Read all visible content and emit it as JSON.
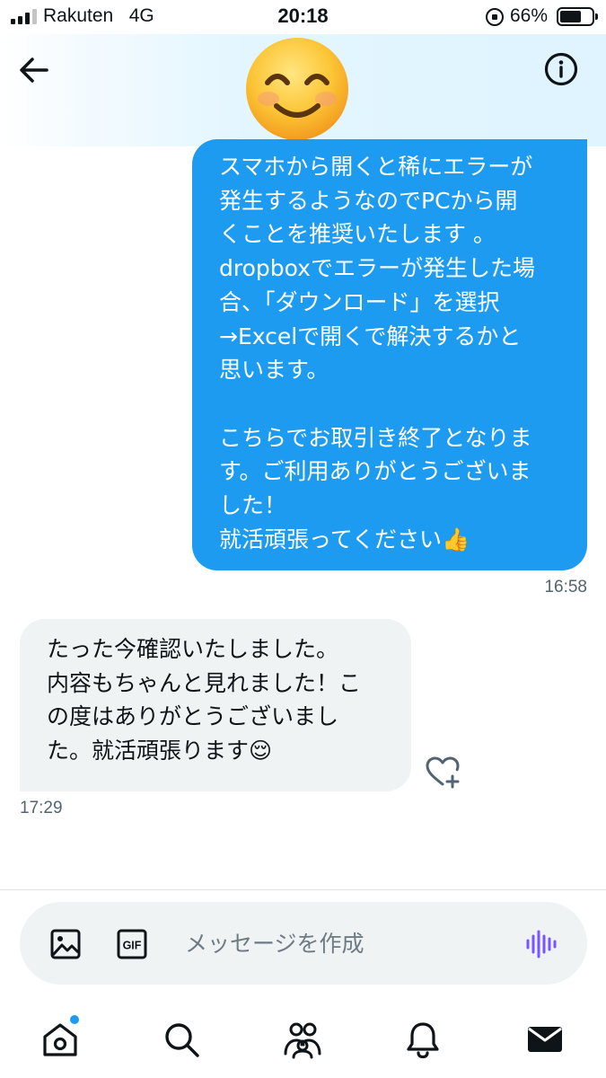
{
  "status_bar": {
    "carrier": "Rakuten",
    "network": "4G",
    "time": "20:18",
    "battery_percent": "66%"
  },
  "header": {
    "avatar_emoji": "😊"
  },
  "messages": [
    {
      "direction": "outgoing",
      "text": "スマホから開くと稀にエラーが\n発生するようなのでPCから開\nくことを推奨いたします 。\ndropboxでエラーが発生した場\n合、「ダウンロード」を選択\n→Excelで開くで解決するかと\n思います。\n\nこちらでお取引き終了となりま\nす。ご利用ありがとうございま\nした！\n就活頑張ってください👍",
      "time": "16:58"
    },
    {
      "direction": "incoming",
      "text": "たった今確認いたしました。\n内容もちゃんと見れました！こ\nの度はありがとうございまし\nた。就活頑張ります😌",
      "time": "17:29"
    }
  ],
  "composer": {
    "placeholder": "メッセージを作成",
    "gif_label": "GIF"
  },
  "icons": {
    "back": "back-arrow-icon",
    "info": "info-icon",
    "react": "heart-plus-icon",
    "image": "image-icon",
    "gif": "gif-icon",
    "voice": "voice-wave-icon",
    "nav": [
      "home-icon",
      "search-icon",
      "communities-icon",
      "notifications-icon",
      "messages-icon"
    ]
  },
  "colors": {
    "accent": "#1d9bf0",
    "incoming_bubble": "#eff3f4",
    "voice_accent": "#7856ff",
    "timestamp": "#536471"
  }
}
